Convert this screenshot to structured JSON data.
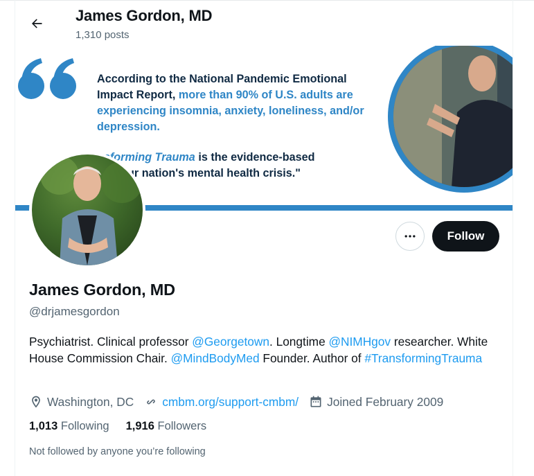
{
  "header": {
    "name": "James Gordon, MD",
    "posts": "1,310 posts"
  },
  "banner": {
    "line1": "According to the National Pandemic Emotional",
    "line2_a": "Impact Report, ",
    "line2_b": "more than 90% of U.S. adults are",
    "line3": "experiencing insomnia, anxiety, loneliness, and/or",
    "line4": "depression.",
    "line5_a": "nsforming Trauma",
    "line5_b": " is the evidence-based",
    "line6": "n to our nation's mental health crisis.\""
  },
  "actions": {
    "follow_label": "Follow"
  },
  "profile": {
    "name": "James Gordon, MD",
    "handle": "@drjamesgordon",
    "bio": {
      "t1": "Psychiatrist. Clinical professor ",
      "l1": "@Georgetown",
      "t2": ". Longtime ",
      "l2": "@NIMHgov",
      "t3": " researcher. White House Commission Chair. ",
      "l3": "@MindBodyMed",
      "t4": " Founder. Author of ",
      "l4": "#TransformingTrauma"
    },
    "location": "Washington, DC",
    "website": "cmbm.org/support-cmbm/",
    "joined": "Joined February 2009",
    "following_count": "1,013",
    "following_label": "Following",
    "followers_count": "1,916",
    "followers_label": "Followers",
    "not_followed": "Not followed by anyone you’re following"
  },
  "icons": {
    "back": "arrow-left-icon",
    "more": "more-dots-icon",
    "location": "location-pin-icon",
    "link": "link-icon",
    "calendar": "calendar-icon"
  },
  "colors": {
    "accent": "#1d9bf0",
    "banner_blue": "#2f86c6",
    "follow_bg": "#0f1419"
  }
}
